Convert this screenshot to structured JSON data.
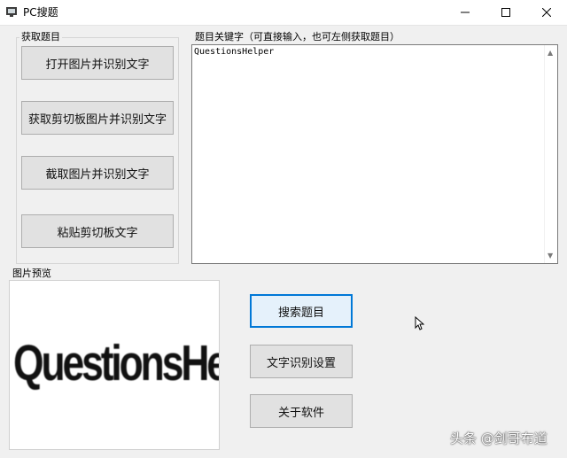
{
  "window": {
    "title": "PC搜题",
    "controls": {
      "minimize_icon": "minimize-icon",
      "maximize_icon": "maximize-icon",
      "close_icon": "close-icon"
    }
  },
  "fetch_group": {
    "label": "获取题目",
    "buttons": [
      {
        "label": "打开图片并识别文字"
      },
      {
        "label": "获取剪切板图片并识别文字"
      },
      {
        "label": "截取图片并识别文字"
      },
      {
        "label": "粘贴剪切板文字"
      }
    ]
  },
  "keyword_group": {
    "label": "题目关键字（可直接输入，也可左侧获取题目）",
    "value": "QuestionsHelper"
  },
  "preview_group": {
    "label": "图片预览",
    "image_text": "QuestionsHelper"
  },
  "actions": {
    "search": "搜索题目",
    "ocr_settings": "文字识别设置",
    "about": "关于软件"
  },
  "watermark": "头条 @剑哥布道",
  "colors": {
    "accent": "#0078d7",
    "button_bg": "#e1e1e1",
    "window_bg": "#f0f0f0"
  }
}
